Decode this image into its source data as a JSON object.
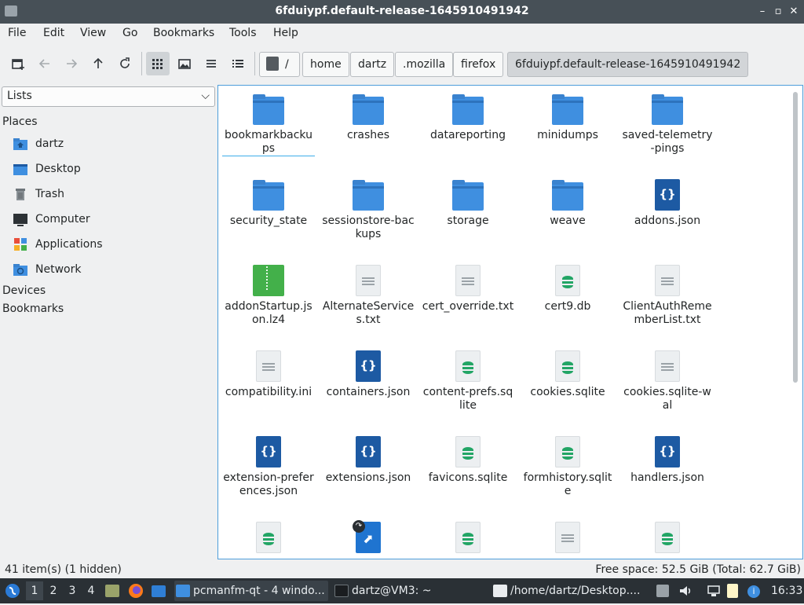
{
  "window": {
    "title": "6fduiypf.default-release-1645910491942",
    "controls": [
      "–",
      "▫",
      "✕"
    ]
  },
  "menu": [
    "File",
    "Edit",
    "View",
    "Go",
    "Bookmarks",
    "Tools",
    "Help"
  ],
  "toolbar": {
    "buttons": [
      "new-tab-icon",
      "back-icon",
      "forward-icon",
      "up-icon",
      "reload-icon",
      "icon-view-icon",
      "thumbnail-view-icon",
      "compact-view-icon",
      "detailed-list-icon"
    ],
    "root_label": "/",
    "breadcrumbs": [
      "home",
      "dartz",
      ".mozilla",
      "firefox",
      "6fduiypf.default-release-1645910491942"
    ]
  },
  "sidebar": {
    "select_value": "Lists",
    "sections": {
      "places": "Places",
      "devices": "Devices",
      "bookmarks": "Bookmarks"
    },
    "places": [
      {
        "label": "dartz",
        "icon": "home-folder-icon"
      },
      {
        "label": "Desktop",
        "icon": "desktop-icon"
      },
      {
        "label": "Trash",
        "icon": "trash-icon"
      },
      {
        "label": "Computer",
        "icon": "computer-icon"
      },
      {
        "label": "Applications",
        "icon": "applications-icon"
      },
      {
        "label": "Network",
        "icon": "network-icon"
      }
    ]
  },
  "files": [
    {
      "name": "bookmarkbackups",
      "type": "folder"
    },
    {
      "name": "crashes",
      "type": "folder"
    },
    {
      "name": "datareporting",
      "type": "folder"
    },
    {
      "name": "minidumps",
      "type": "folder"
    },
    {
      "name": "saved-telemetry-pings",
      "type": "folder"
    },
    {
      "name": "security_state",
      "type": "folder"
    },
    {
      "name": "sessionstore-backups",
      "type": "folder"
    },
    {
      "name": "storage",
      "type": "folder"
    },
    {
      "name": "weave",
      "type": "folder"
    },
    {
      "name": "addons.json",
      "type": "json"
    },
    {
      "name": "addonStartup.json.lz4",
      "type": "zip"
    },
    {
      "name": "AlternateServices.txt",
      "type": "txt"
    },
    {
      "name": "cert_override.txt",
      "type": "txt"
    },
    {
      "name": "cert9.db",
      "type": "db"
    },
    {
      "name": "ClientAuthRememberList.txt",
      "type": "txt"
    },
    {
      "name": "compatibility.ini",
      "type": "txt"
    },
    {
      "name": "containers.json",
      "type": "json"
    },
    {
      "name": "content-prefs.sqlite",
      "type": "db"
    },
    {
      "name": "cookies.sqlite",
      "type": "db"
    },
    {
      "name": "cookies.sqlite-wal",
      "type": "txt"
    },
    {
      "name": "extension-preferences.json",
      "type": "json"
    },
    {
      "name": "extensions.json",
      "type": "json"
    },
    {
      "name": "favicons.sqlite",
      "type": "db"
    },
    {
      "name": "formhistory.sqlite",
      "type": "db"
    },
    {
      "name": "handlers.json",
      "type": "json"
    },
    {
      "name": "",
      "type": "db"
    },
    {
      "name": "",
      "type": "lnk"
    },
    {
      "name": "",
      "type": "db"
    },
    {
      "name": "",
      "type": "txt"
    },
    {
      "name": "",
      "type": "db"
    }
  ],
  "status": {
    "left": "41 item(s) (1 hidden)",
    "right": "Free space: 52.5 GiB (Total: 62.7 GiB)"
  },
  "taskbar": {
    "workspaces": [
      "1",
      "2",
      "3",
      "4"
    ],
    "tasks": [
      {
        "label": "pcmanfm-qt - 4 windo...",
        "icon": "file-manager-icon"
      },
      {
        "label": "dartz@VM3: ~",
        "icon": "terminal-icon"
      },
      {
        "label": "/home/dartz/Desktop....",
        "icon": "document-viewer-icon"
      }
    ],
    "clock": "16:33"
  }
}
